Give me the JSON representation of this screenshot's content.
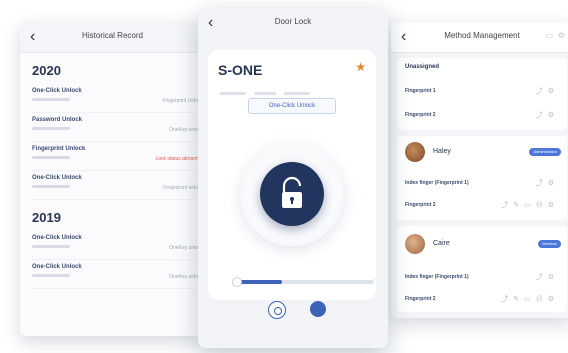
{
  "history": {
    "title": "Historical Record",
    "back_icon": "chevron-left-icon",
    "groups": [
      {
        "year": "2020",
        "records": [
          {
            "label": "One-Click Unlock",
            "value": "Fingerprint Unlock",
            "status": "normal"
          },
          {
            "label": "Password Unlock",
            "value": "OneKey unlock",
            "status": "normal"
          },
          {
            "label": "Fingerprint Unlock",
            "value": "Lock status abnormal",
            "status": "warning"
          },
          {
            "label": "One-Click Unlock",
            "value": "Fingerprint unlock",
            "status": "normal"
          }
        ]
      },
      {
        "year": "2019",
        "records": [
          {
            "label": "One-Click Unlock",
            "value": "OneKey unlock",
            "status": "normal"
          },
          {
            "label": "One-Click Unlock",
            "value": "OneKey unlock",
            "status": "normal"
          }
        ]
      }
    ]
  },
  "door_lock": {
    "title": "Door Lock",
    "device_name": "S-ONE",
    "favorite_icon": "star-icon",
    "one_click_label": "One-Click Unlock",
    "lock_icon": "padlock-open-icon",
    "slider_value": 0.3,
    "accent_color": "#22355e",
    "controls": [
      "settings-icon",
      "user-icon"
    ]
  },
  "methods": {
    "title": "Method Management",
    "unassigned": {
      "caption": "Unassigned",
      "items": [
        "Fingerprint 1",
        "Fingerprint 2"
      ]
    },
    "users": [
      {
        "name": "Haley",
        "badge": "Administrator",
        "items": [
          "Index finger (Fingerprint 1)",
          "Fingerprint 2"
        ]
      },
      {
        "name": "Caire",
        "badge": "Member",
        "items": [
          "Index finger (Fingerprint 1)",
          "Fingerprint 2"
        ]
      }
    ]
  }
}
